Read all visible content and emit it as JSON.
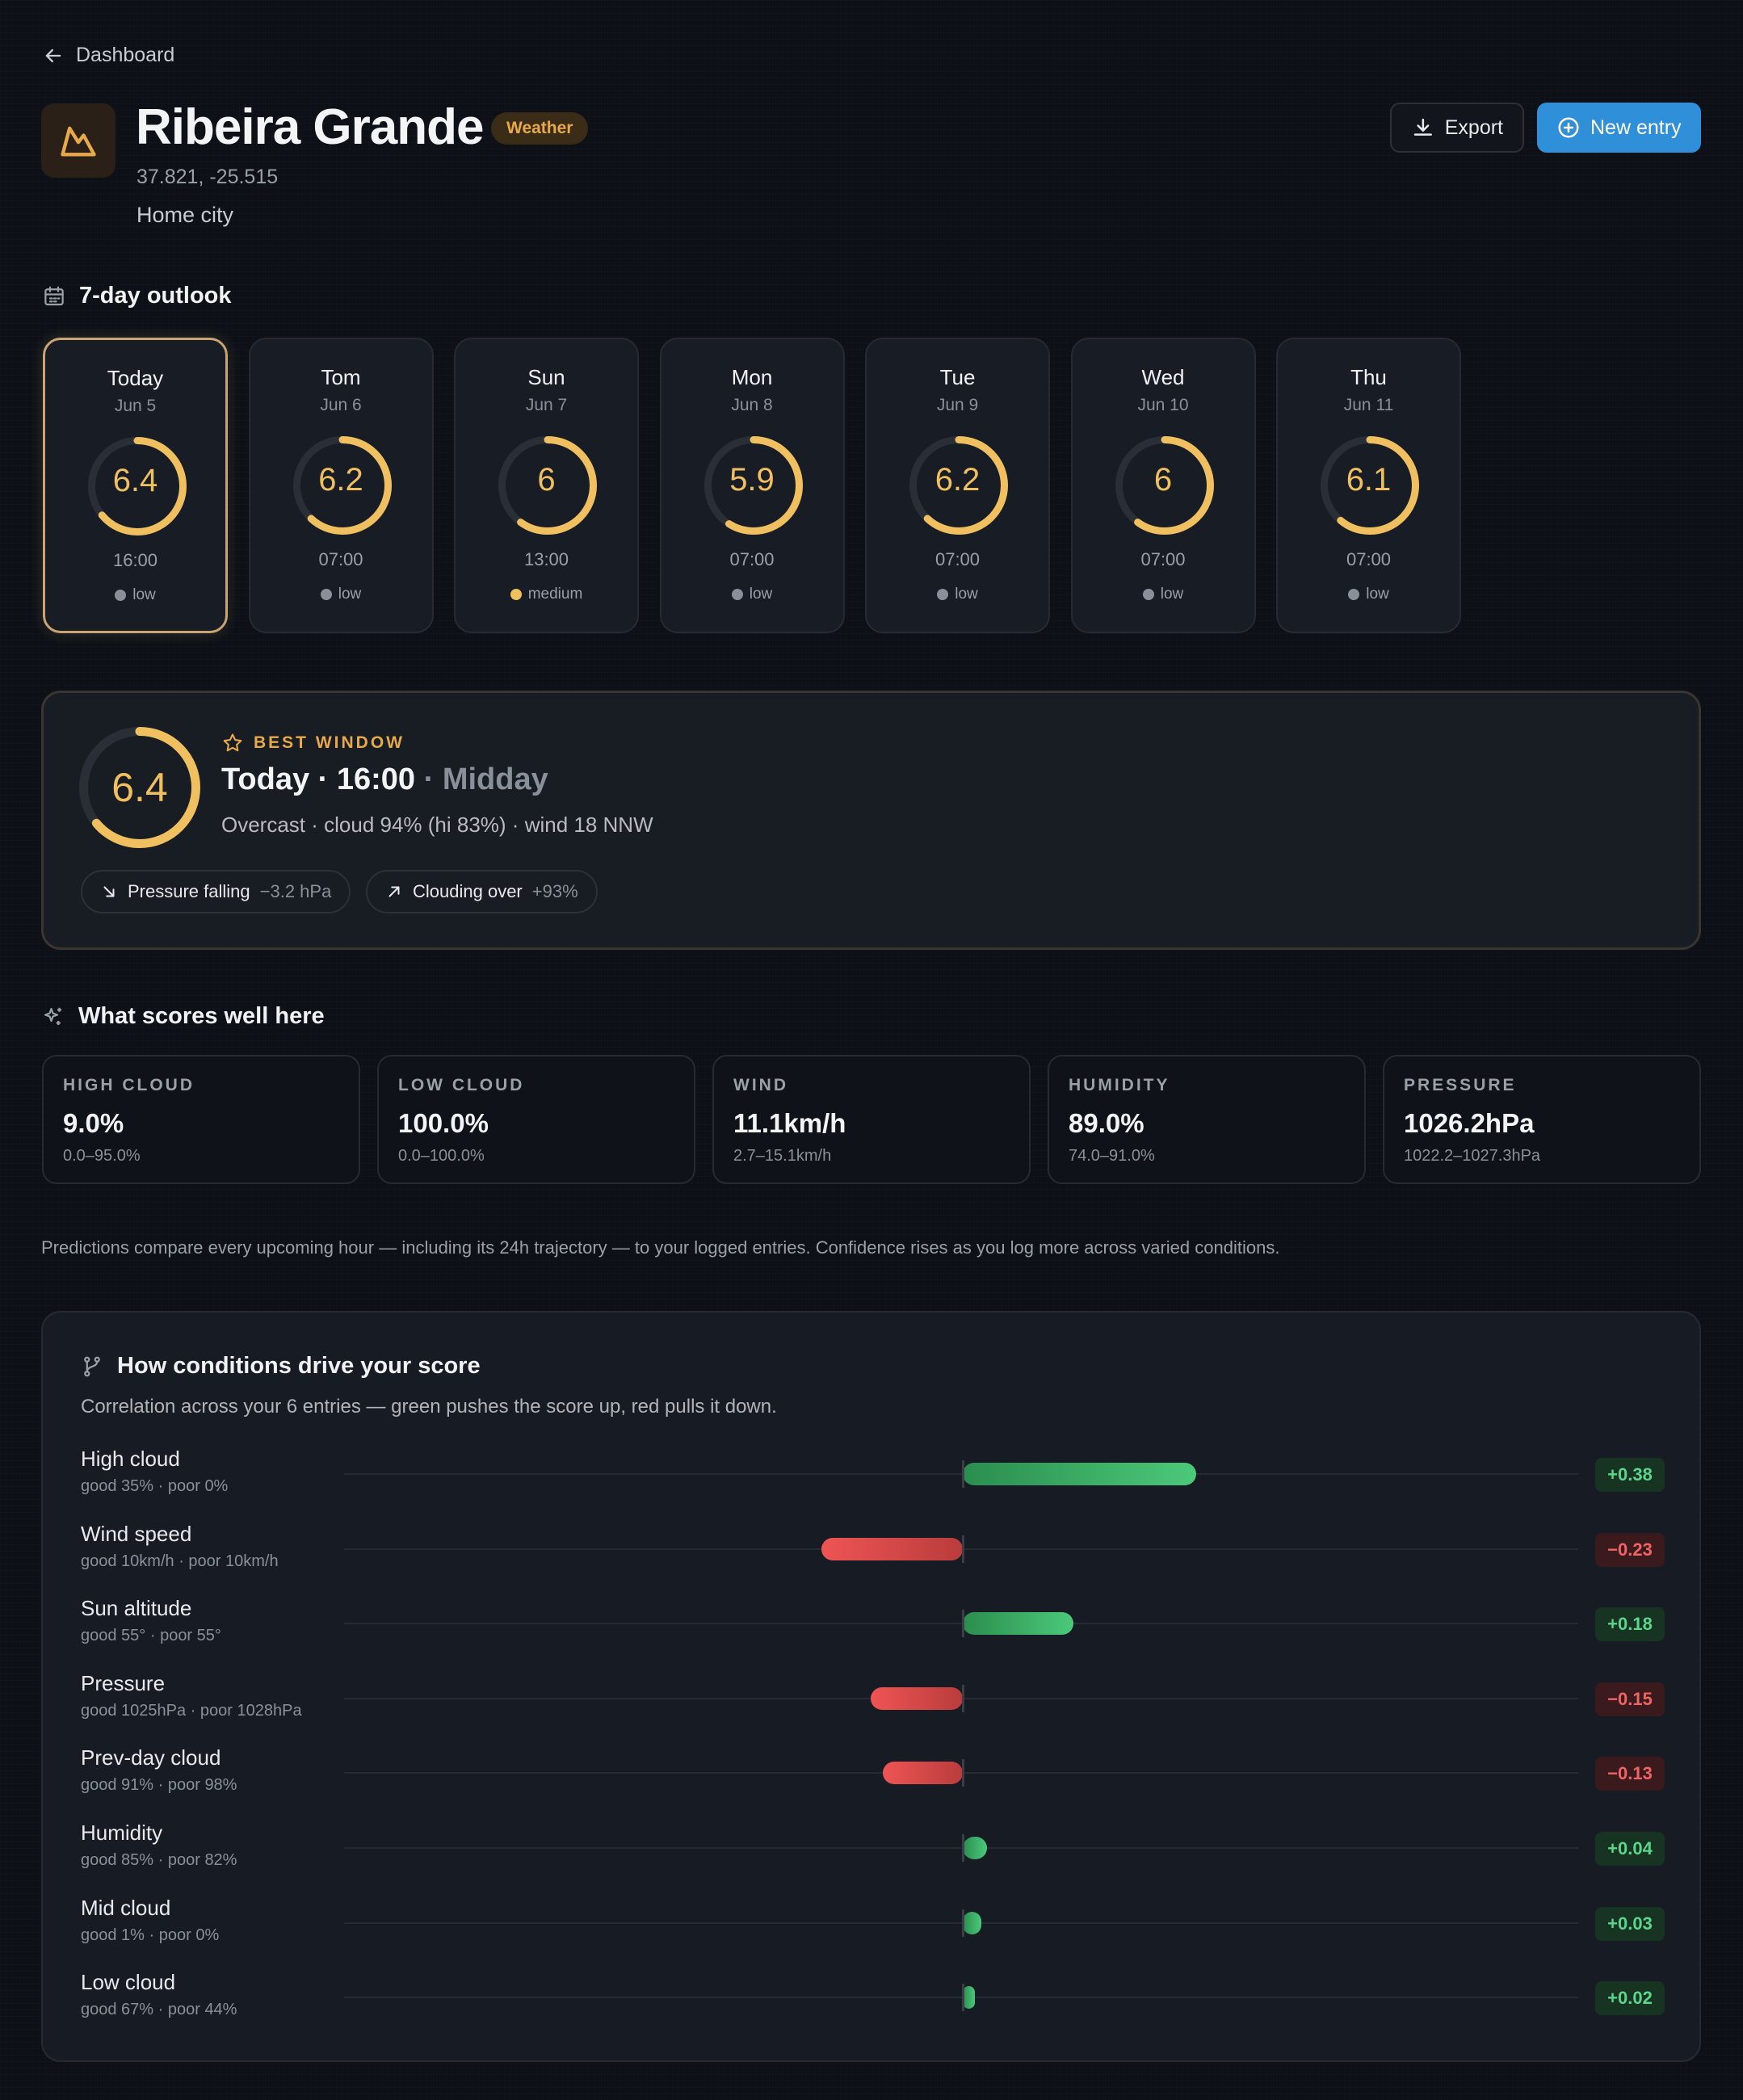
{
  "nav": {
    "back_label": "Dashboard"
  },
  "header": {
    "title": "Ribeira Grande",
    "badge": "Weather",
    "coords": "37.821, -25.515",
    "subtitle": "Home city",
    "export_label": "Export",
    "new_entry_label": "New entry"
  },
  "outlook": {
    "heading": "7-day outlook",
    "days": [
      {
        "name": "Today",
        "date": "Jun 5",
        "score": "6.4",
        "score_value": 6.4,
        "time": "16:00",
        "confidence": "low"
      },
      {
        "name": "Tom",
        "date": "Jun 6",
        "score": "6.2",
        "score_value": 6.2,
        "time": "07:00",
        "confidence": "low"
      },
      {
        "name": "Sun",
        "date": "Jun 7",
        "score": "6",
        "score_value": 6.0,
        "time": "13:00",
        "confidence": "medium"
      },
      {
        "name": "Mon",
        "date": "Jun 8",
        "score": "5.9",
        "score_value": 5.9,
        "time": "07:00",
        "confidence": "low"
      },
      {
        "name": "Tue",
        "date": "Jun 9",
        "score": "6.2",
        "score_value": 6.2,
        "time": "07:00",
        "confidence": "low"
      },
      {
        "name": "Wed",
        "date": "Jun 10",
        "score": "6",
        "score_value": 6.0,
        "time": "07:00",
        "confidence": "low"
      },
      {
        "name": "Thu",
        "date": "Jun 11",
        "score": "6.1",
        "score_value": 6.1,
        "time": "07:00",
        "confidence": "low"
      }
    ]
  },
  "best_window": {
    "label": "BEST WINDOW",
    "score": "6.4",
    "score_value": 6.4,
    "title_main": "Today · 16:00",
    "title_muted": "· Midday",
    "description": "Overcast · cloud 94% (hi 83%) · wind 18 NNW",
    "chips": [
      {
        "label": "Pressure falling",
        "value": "−3.2 hPa"
      },
      {
        "label": "Clouding over",
        "value": "+93%"
      }
    ]
  },
  "scores_well": {
    "heading": "What scores well here",
    "stats": [
      {
        "label": "HIGH CLOUD",
        "value": "9.0%",
        "range": "0.0–95.0%"
      },
      {
        "label": "LOW CLOUD",
        "value": "100.0%",
        "range": "0.0–100.0%"
      },
      {
        "label": "WIND",
        "value": "11.1km/h",
        "range": "2.7–15.1km/h"
      },
      {
        "label": "HUMIDITY",
        "value": "89.0%",
        "range": "74.0–91.0%"
      },
      {
        "label": "PRESSURE",
        "value": "1026.2hPa",
        "range": "1022.2–1027.3hPa"
      }
    ]
  },
  "note": "Predictions compare every upcoming hour — including its 24h trajectory — to your logged entries. Confidence rises as you log more across varied conditions.",
  "conditions": {
    "heading": "How conditions drive your score",
    "subtitle": "Correlation across your 6 entries — green pushes the score up, red pulls it down.",
    "rows": [
      {
        "name": "High cloud",
        "detail": "good 35% · poor 0%",
        "value": 0.38,
        "label": "+0.38"
      },
      {
        "name": "Wind speed",
        "detail": "good 10km/h · poor 10km/h",
        "value": -0.23,
        "label": "−0.23"
      },
      {
        "name": "Sun altitude",
        "detail": "good 55° · poor 55°",
        "value": 0.18,
        "label": "+0.18"
      },
      {
        "name": "Pressure",
        "detail": "good 1025hPa · poor 1028hPa",
        "value": -0.15,
        "label": "−0.15"
      },
      {
        "name": "Prev-day cloud",
        "detail": "good 91% · poor 98%",
        "value": -0.13,
        "label": "−0.13"
      },
      {
        "name": "Humidity",
        "detail": "good 85% · poor 82%",
        "value": 0.04,
        "label": "+0.04"
      },
      {
        "name": "Mid cloud",
        "detail": "good 1% · poor 0%",
        "value": 0.03,
        "label": "+0.03"
      },
      {
        "name": "Low cloud",
        "detail": "good 67% · poor 44%",
        "value": 0.02,
        "label": "+0.02"
      }
    ]
  },
  "colors": {
    "accent_gold": "#f0c060",
    "accent_blue": "#2f8fd8",
    "positive": "#4cc97a",
    "negative": "#ef5454"
  },
  "icons": {
    "back": "arrow-left-icon",
    "logo": "mountain-icon",
    "export": "download-icon",
    "new_entry": "plus-circle-icon",
    "outlook": "calendar-icon",
    "best": "star-icon",
    "scores": "sparkle-icon",
    "conditions": "branch-icon"
  }
}
